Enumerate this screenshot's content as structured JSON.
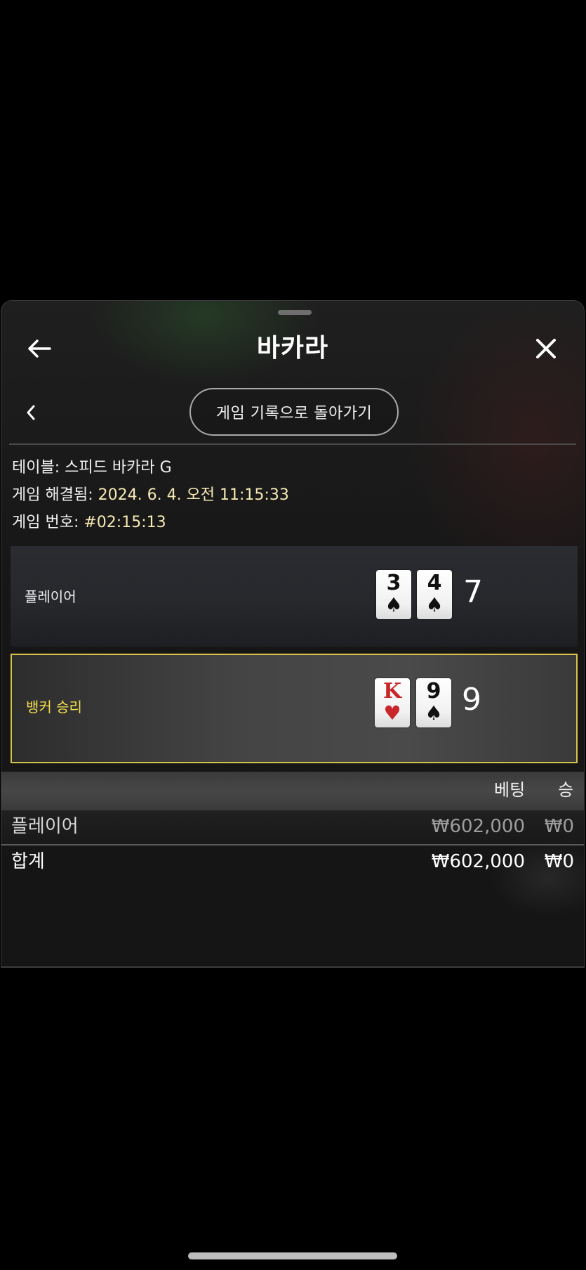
{
  "header": {
    "title": "바카라",
    "back_icon": "arrow-left-icon",
    "close_icon": "close-icon"
  },
  "nav": {
    "chevron_icon": "chevron-left-icon",
    "history_button_label": "게임 기록으로 돌아가기"
  },
  "info": {
    "table_label": "테이블: ",
    "table_value": "스피드 바카라 G",
    "resolved_label": "게임 해결됨: ",
    "resolved_value": "2024. 6. 4. 오전 11:15:33",
    "number_label": "게임 번호: ",
    "number_value": "#02:15:13"
  },
  "hands": {
    "player": {
      "label": "플레이어",
      "cards": [
        {
          "rank": "3",
          "suit": "♠",
          "color": "black"
        },
        {
          "rank": "4",
          "suit": "♠",
          "color": "black"
        }
      ],
      "total": "7"
    },
    "banker": {
      "label": "뱅커 승리",
      "highlight_color": "#d6c24a",
      "cards": [
        {
          "rank": "K",
          "suit": "♥",
          "color": "red"
        },
        {
          "rank": "9",
          "suit": "♠",
          "color": "black"
        }
      ],
      "total": "9"
    }
  },
  "bets_table": {
    "headers": {
      "bet": "베팅",
      "win": "승"
    },
    "rows": [
      {
        "name": "플레이어",
        "bet": "₩602,000",
        "win": "₩0"
      }
    ],
    "total": {
      "name": "합계",
      "bet": "₩602,000",
      "win": "₩0"
    }
  },
  "colors": {
    "winner_text": "#f3dc4f",
    "info_value": "#f6e9b4"
  }
}
